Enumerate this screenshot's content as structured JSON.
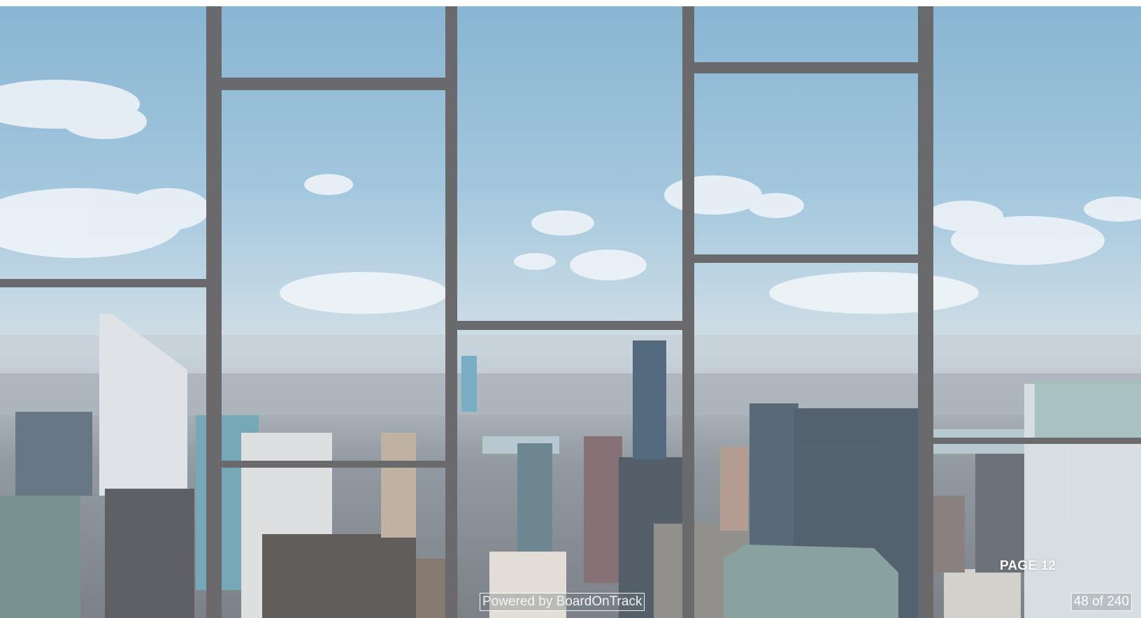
{
  "slide": {
    "background_description_icon": "city-skyline-window-image",
    "page_label": "PAGE 12",
    "page_count": "48 of 240",
    "powered_by": "Powered by BoardOnTrack"
  },
  "colors": {
    "sky": "#7fb1d0",
    "frame": "#4b4b4d",
    "label_text": "#ffffff"
  }
}
